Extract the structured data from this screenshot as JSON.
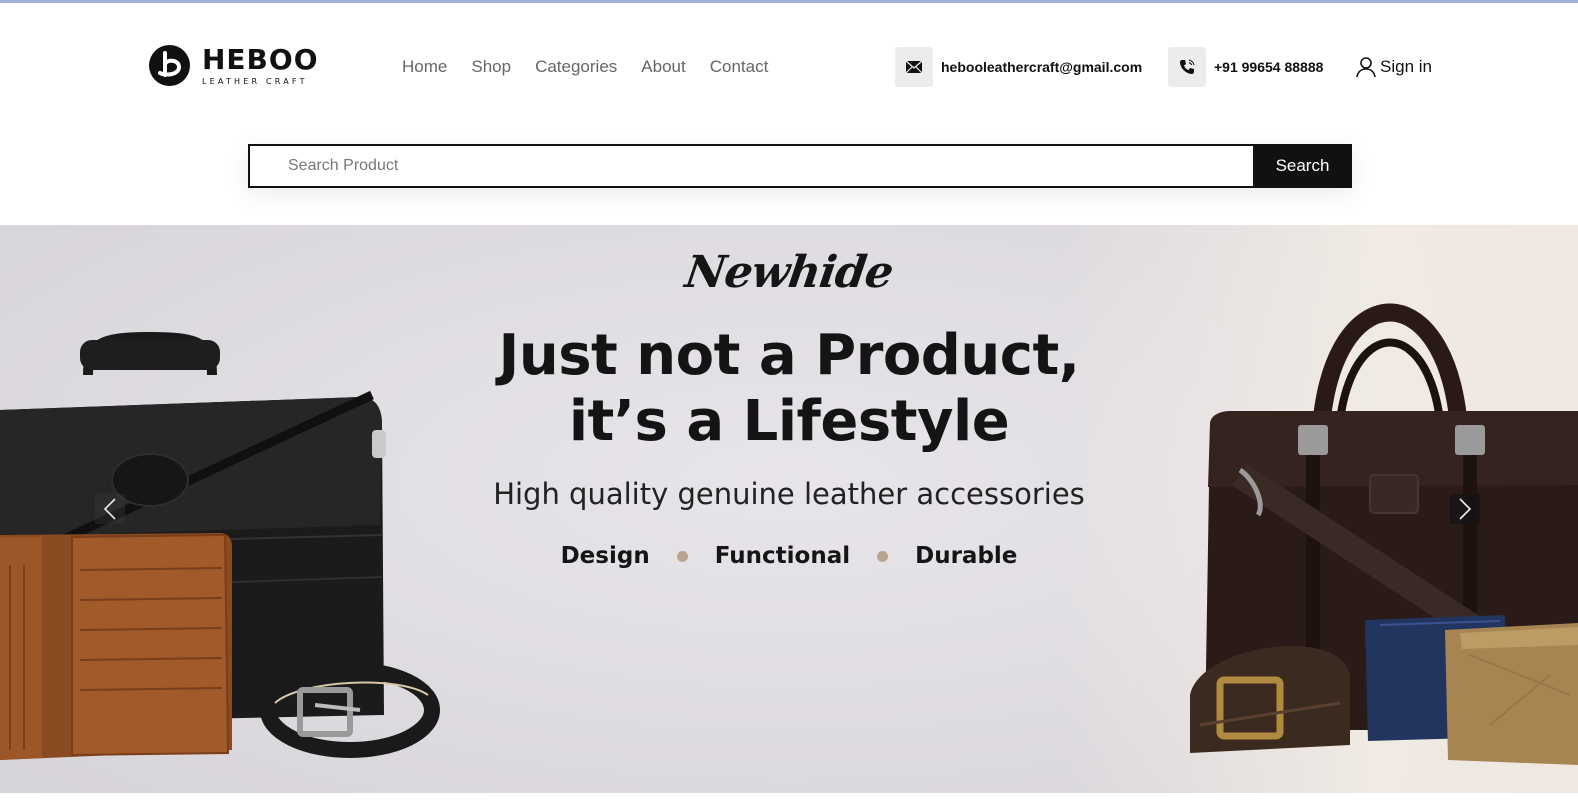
{
  "brand": {
    "name": "HEBOO",
    "tagline": "LEATHER CRAFT"
  },
  "nav": {
    "items": [
      {
        "label": "Home"
      },
      {
        "label": "Shop"
      },
      {
        "label": "Categories"
      },
      {
        "label": "About"
      },
      {
        "label": "Contact"
      }
    ]
  },
  "contact": {
    "email": "hebooleathercraft@gmail.com",
    "phone": "+91 99654 88888"
  },
  "account": {
    "signin_label": "Sign in"
  },
  "search": {
    "placeholder": "Search Product",
    "value": "",
    "button_label": "Search"
  },
  "hero": {
    "brand_script": "Newhide",
    "headline_line1": "Just not a Product,",
    "headline_line2": "it’s a Lifestyle",
    "subline": "High quality genuine leather accessories",
    "features": [
      "Design",
      "Functional",
      "Durable"
    ],
    "accent_color": "#b9a58f"
  }
}
